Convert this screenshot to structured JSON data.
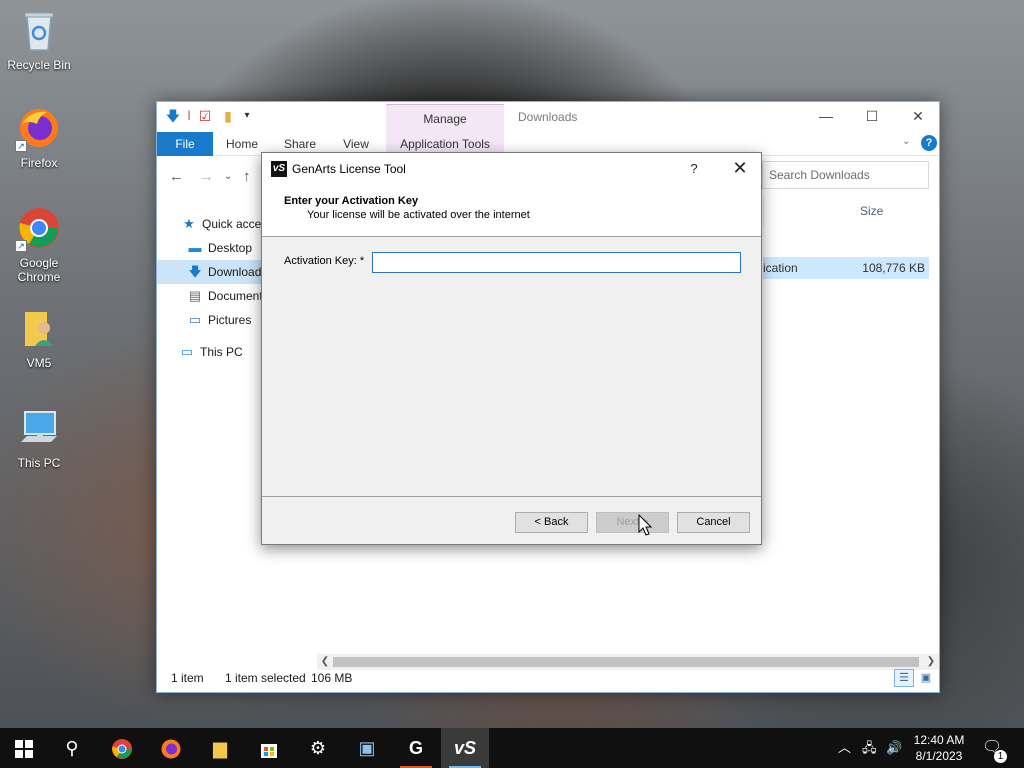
{
  "desktop": {
    "icons": [
      {
        "label": "Recycle Bin"
      },
      {
        "label": "Firefox"
      },
      {
        "label": "Google Chrome"
      },
      {
        "label": "VM5"
      },
      {
        "label": "This PC"
      }
    ]
  },
  "explorer": {
    "title": "Downloads",
    "manage_tab": "Manage",
    "tabs": [
      "File",
      "Home",
      "Share",
      "View",
      "Application Tools"
    ],
    "search_placeholder": "Search Downloads",
    "nav": [
      "Quick access",
      "Desktop",
      "Downloads",
      "Documents",
      "Pictures",
      "This PC"
    ],
    "column_size": "Size",
    "file_type_fragment": "ication",
    "file_size": "108,776 KB",
    "status": {
      "count": "1 item",
      "selection": "1 item selected",
      "size": "106 MB"
    }
  },
  "dialog": {
    "title": "GenArts License Tool",
    "logo": "vS",
    "help": "?",
    "heading": "Enter your Activation Key",
    "subheading": "Your license will be activated over the internet",
    "field_label": "Activation Key: *",
    "field_value": "",
    "buttons": {
      "back": "< Back",
      "next": "Next >",
      "cancel": "Cancel"
    }
  },
  "taskbar": {
    "time": "12:40 AM",
    "date": "8/1/2023",
    "notification_count": "1"
  },
  "colors": {
    "accent": "#1979ca",
    "selection": "#cce4f7",
    "manage_tab": "#f3e7f5",
    "taskbar": "#101010"
  }
}
